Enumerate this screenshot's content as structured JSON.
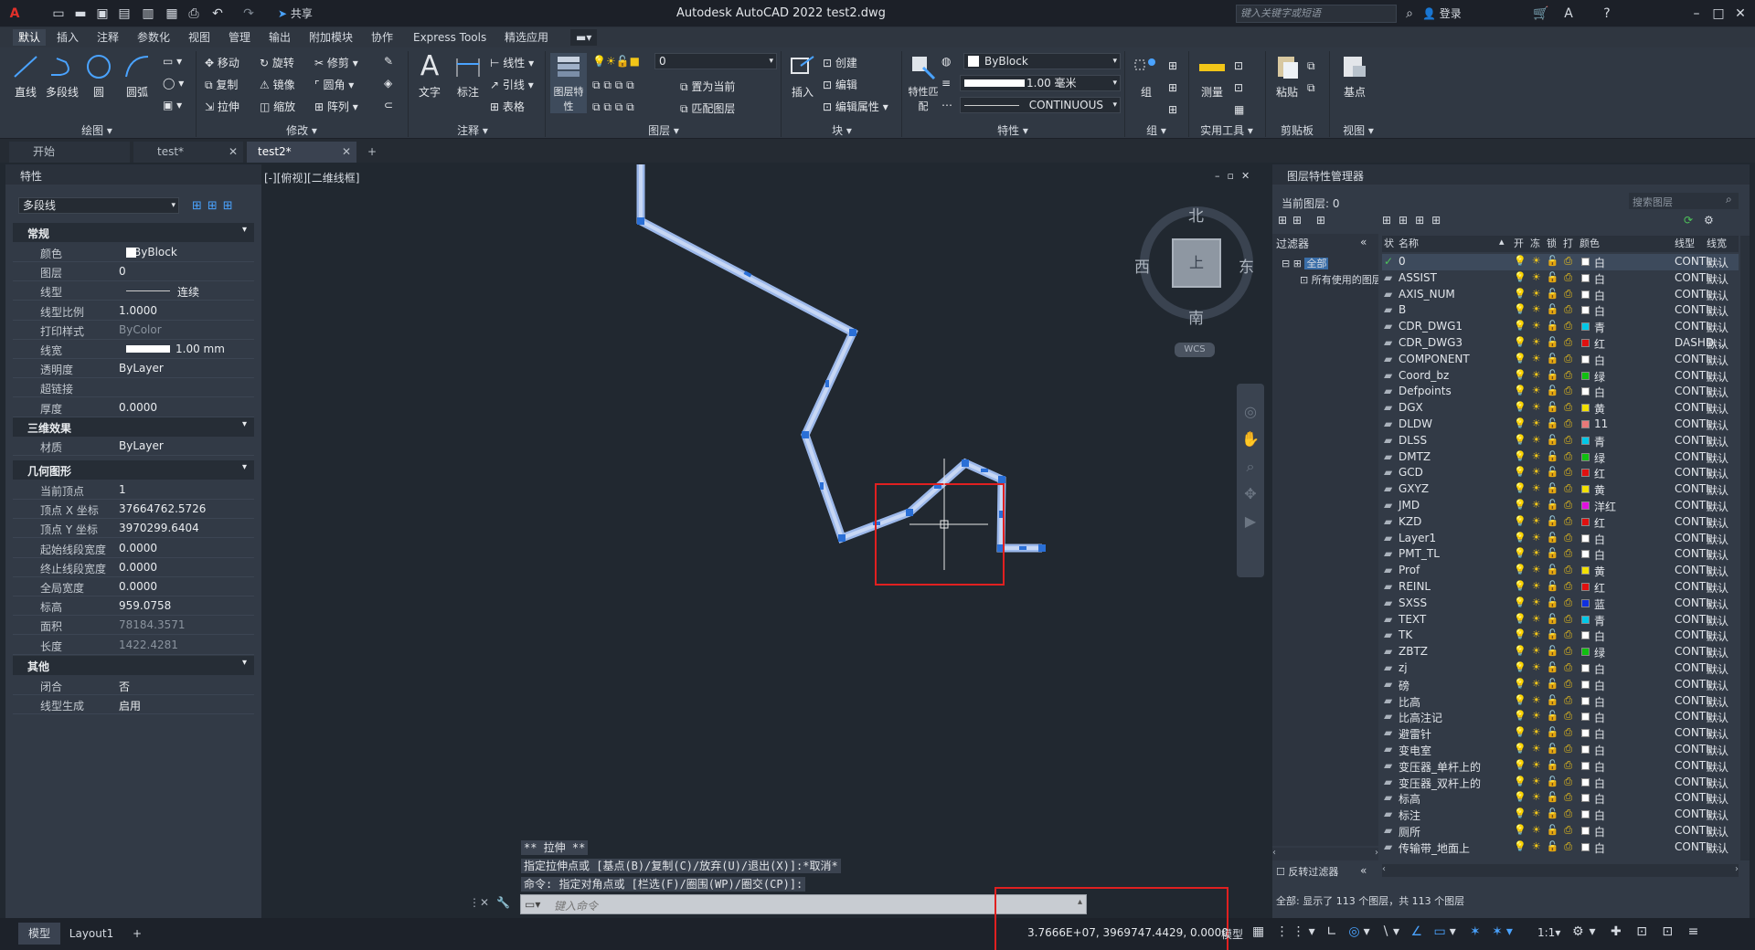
{
  "app": {
    "title": "Autodesk AutoCAD 2022    test2.dwg",
    "share_label": "共享",
    "search_placeholder": "键入关键字或短语",
    "login_label": "登录"
  },
  "menu_tabs": [
    "默认",
    "插入",
    "注释",
    "参数化",
    "视图",
    "管理",
    "输出",
    "附加模块",
    "协作",
    "Express Tools",
    "精选应用"
  ],
  "ribbon": {
    "draw": {
      "line": "直线",
      "polyline": "多段线",
      "circle": "圆",
      "arc": "圆弧",
      "label": "绘图"
    },
    "modify": {
      "move": "移动",
      "rotate": "旋转",
      "trim": "修剪",
      "copy": "复制",
      "mirror": "镜像",
      "fillet": "圆角",
      "stretch": "拉伸",
      "scale": "缩放",
      "array": "阵列",
      "label": "修改"
    },
    "annotation": {
      "text": "文字",
      "dim": "标注",
      "linear": "线性",
      "leader": "引线",
      "table": "表格",
      "label": "注释"
    },
    "layers": {
      "layer_props": "图层特性",
      "current_layer": "0",
      "make_current": "置为当前",
      "match_layer": "匹配图层",
      "label": "图层"
    },
    "block": {
      "insert": "插入",
      "create": "创建",
      "edit": "编辑",
      "edit_attr": "编辑属性",
      "label": "块"
    },
    "properties": {
      "match_props": "特性匹配",
      "color": "ByBlock",
      "lineweight": "1.00 毫米",
      "linetype": "CONTINUOUS",
      "label": "特性"
    },
    "groups": {
      "group": "组",
      "label": "组"
    },
    "utilities": {
      "measure": "测量",
      "label": "实用工具"
    },
    "clipboard": {
      "paste": "粘贴",
      "label": "剪贴板"
    },
    "view": {
      "base": "基点",
      "label": "视图"
    }
  },
  "doc_tabs": [
    {
      "label": "开始"
    },
    {
      "label": "test*"
    },
    {
      "label": "test2*"
    }
  ],
  "properties_panel": {
    "title": "特性",
    "object_type": "多段线",
    "general_title": "常规",
    "general": [
      {
        "k": "颜色",
        "v": "ByBlock"
      },
      {
        "k": "图层",
        "v": "0"
      },
      {
        "k": "线型",
        "v": "连续"
      },
      {
        "k": "线型比例",
        "v": "1.0000"
      },
      {
        "k": "打印样式",
        "v": "ByColor"
      },
      {
        "k": "线宽",
        "v": "1.00 mm"
      },
      {
        "k": "透明度",
        "v": "ByLayer"
      },
      {
        "k": "超链接",
        "v": ""
      },
      {
        "k": "厚度",
        "v": "0.0000"
      }
    ],
    "threed_title": "三维效果",
    "threed": [
      {
        "k": "材质",
        "v": "ByLayer"
      }
    ],
    "geom_title": "几何图形",
    "geom": [
      {
        "k": "当前顶点",
        "v": "1"
      },
      {
        "k": "顶点 X 坐标",
        "v": "37664762.5726"
      },
      {
        "k": "顶点 Y 坐标",
        "v": "3970299.6404"
      },
      {
        "k": "起始线段宽度",
        "v": "0.0000"
      },
      {
        "k": "终止线段宽度",
        "v": "0.0000"
      },
      {
        "k": "全局宽度",
        "v": "0.0000"
      },
      {
        "k": "标高",
        "v": "959.0758"
      },
      {
        "k": "面积",
        "v": "78184.3571"
      },
      {
        "k": "长度",
        "v": "1422.4281"
      }
    ],
    "other_title": "其他",
    "other": [
      {
        "k": "闭合",
        "v": "否"
      },
      {
        "k": "线型生成",
        "v": "启用"
      }
    ]
  },
  "viewport": {
    "label": "[-][俯视][二维线框]",
    "compass": {
      "n": "北",
      "s": "南",
      "e": "东",
      "w": "西",
      "center": "上",
      "wcs": "WCS"
    }
  },
  "command": {
    "history": [
      "** 拉伸 **",
      "指定拉伸点或 [基点(B)/复制(C)/放弃(U)/退出(X)]:*取消*",
      "命令: 指定对角点或 [栏选(F)/圈围(WP)/圈交(CP)]:"
    ],
    "placeholder": "键入命令"
  },
  "layer_manager": {
    "title": "图层特性管理器",
    "current": "当前图层: 0",
    "search_placeholder": "搜索图层",
    "filters_label": "过滤器",
    "filter_all": "全部",
    "filter_used": "所有使用的图层",
    "invert_filter": "反转过滤器",
    "columns": [
      "状",
      "名称",
      "开",
      "冻",
      "锁",
      "打",
      "颜色",
      "线型",
      "线宽"
    ],
    "rows": [
      {
        "name": "0",
        "color": "#ffffff",
        "cname": "白",
        "lt": "CONTI...",
        "lw": "默认"
      },
      {
        "name": "ASSIST",
        "color": "#ffffff",
        "cname": "白",
        "lt": "CONTI...",
        "lw": "默认"
      },
      {
        "name": "AXIS_NUM",
        "color": "#ffffff",
        "cname": "白",
        "lt": "CONTI...",
        "lw": "默认"
      },
      {
        "name": "B",
        "color": "#ffffff",
        "cname": "白",
        "lt": "CONTI...",
        "lw": "默认"
      },
      {
        "name": "CDR_DWG1",
        "color": "#00c8e8",
        "cname": "青",
        "lt": "CONTI...",
        "lw": "默认"
      },
      {
        "name": "CDR_DWG3",
        "color": "#e01010",
        "cname": "红",
        "lt": "DASHD...",
        "lw": "默认"
      },
      {
        "name": "COMPONENT",
        "color": "#ffffff",
        "cname": "白",
        "lt": "CONTI...",
        "lw": "默认"
      },
      {
        "name": "Coord_bz",
        "color": "#10c010",
        "cname": "绿",
        "lt": "CONTI...",
        "lw": "默认"
      },
      {
        "name": "Defpoints",
        "color": "#ffffff",
        "cname": "白",
        "lt": "CONTI...",
        "lw": "默认"
      },
      {
        "name": "DGX",
        "color": "#f2e000",
        "cname": "黄",
        "lt": "CONTI...",
        "lw": "默认"
      },
      {
        "name": "DLDW",
        "color": "#e87878",
        "cname": "11",
        "lt": "CONTI...",
        "lw": "默认"
      },
      {
        "name": "DLSS",
        "color": "#00c8e8",
        "cname": "青",
        "lt": "CONTI...",
        "lw": "默认"
      },
      {
        "name": "DMTZ",
        "color": "#10c010",
        "cname": "绿",
        "lt": "CONTI...",
        "lw": "默认"
      },
      {
        "name": "GCD",
        "color": "#e01010",
        "cname": "红",
        "lt": "CONTI...",
        "lw": "默认"
      },
      {
        "name": "GXYZ",
        "color": "#f2e000",
        "cname": "黄",
        "lt": "CONTI...",
        "lw": "默认"
      },
      {
        "name": "JMD",
        "color": "#e010e0",
        "cname": "洋红",
        "lt": "CONTI...",
        "lw": "默认"
      },
      {
        "name": "KZD",
        "color": "#e01010",
        "cname": "红",
        "lt": "CONTI...",
        "lw": "默认"
      },
      {
        "name": "Layer1",
        "color": "#ffffff",
        "cname": "白",
        "lt": "CONTI...",
        "lw": "默认"
      },
      {
        "name": "PMT_TL",
        "color": "#ffffff",
        "cname": "白",
        "lt": "CONTI...",
        "lw": "默认"
      },
      {
        "name": "Prof",
        "color": "#f2e000",
        "cname": "黄",
        "lt": "CONTI...",
        "lw": "默认"
      },
      {
        "name": "REINL",
        "color": "#e01010",
        "cname": "红",
        "lt": "CONTI...",
        "lw": "默认"
      },
      {
        "name": "SXSS",
        "color": "#1030e0",
        "cname": "蓝",
        "lt": "CONTI...",
        "lw": "默认"
      },
      {
        "name": "TEXT",
        "color": "#00c8e8",
        "cname": "青",
        "lt": "CONTI...",
        "lw": "默认"
      },
      {
        "name": "TK",
        "color": "#ffffff",
        "cname": "白",
        "lt": "CONTI...",
        "lw": "默认"
      },
      {
        "name": "ZBTZ",
        "color": "#10c010",
        "cname": "绿",
        "lt": "CONTI...",
        "lw": "默认"
      },
      {
        "name": "zj",
        "color": "#ffffff",
        "cname": "白",
        "lt": "CONTI...",
        "lw": "默认"
      },
      {
        "name": "磅",
        "color": "#ffffff",
        "cname": "白",
        "lt": "CONTI...",
        "lw": "默认"
      },
      {
        "name": "比高",
        "color": "#ffffff",
        "cname": "白",
        "lt": "CONTI...",
        "lw": "默认"
      },
      {
        "name": "比高注记",
        "color": "#ffffff",
        "cname": "白",
        "lt": "CONTI...",
        "lw": "默认"
      },
      {
        "name": "避雷针",
        "color": "#ffffff",
        "cname": "白",
        "lt": "CONTI...",
        "lw": "默认"
      },
      {
        "name": "变电室",
        "color": "#ffffff",
        "cname": "白",
        "lt": "CONTI...",
        "lw": "默认"
      },
      {
        "name": "变压器_单杆上的",
        "color": "#ffffff",
        "cname": "白",
        "lt": "CONTI...",
        "lw": "默认"
      },
      {
        "name": "变压器_双杆上的",
        "color": "#ffffff",
        "cname": "白",
        "lt": "CONTI...",
        "lw": "默认"
      },
      {
        "name": "标高",
        "color": "#ffffff",
        "cname": "白",
        "lt": "CONTI...",
        "lw": "默认"
      },
      {
        "name": "标注",
        "color": "#ffffff",
        "cname": "白",
        "lt": "CONTI...",
        "lw": "默认"
      },
      {
        "name": "厕所",
        "color": "#ffffff",
        "cname": "白",
        "lt": "CONTI...",
        "lw": "默认"
      },
      {
        "name": "传输带_地面上",
        "color": "#ffffff",
        "cname": "白",
        "lt": "CONTI...",
        "lw": "默认"
      }
    ],
    "summary": "全部: 显示了 113 个图层，共 113 个图层"
  },
  "status": {
    "model_tab": "模型",
    "layout_tab": "Layout1",
    "coords": "3.7666E+07, 3969747.4429, 0.0000",
    "model": "模型",
    "scale": "1:1"
  }
}
